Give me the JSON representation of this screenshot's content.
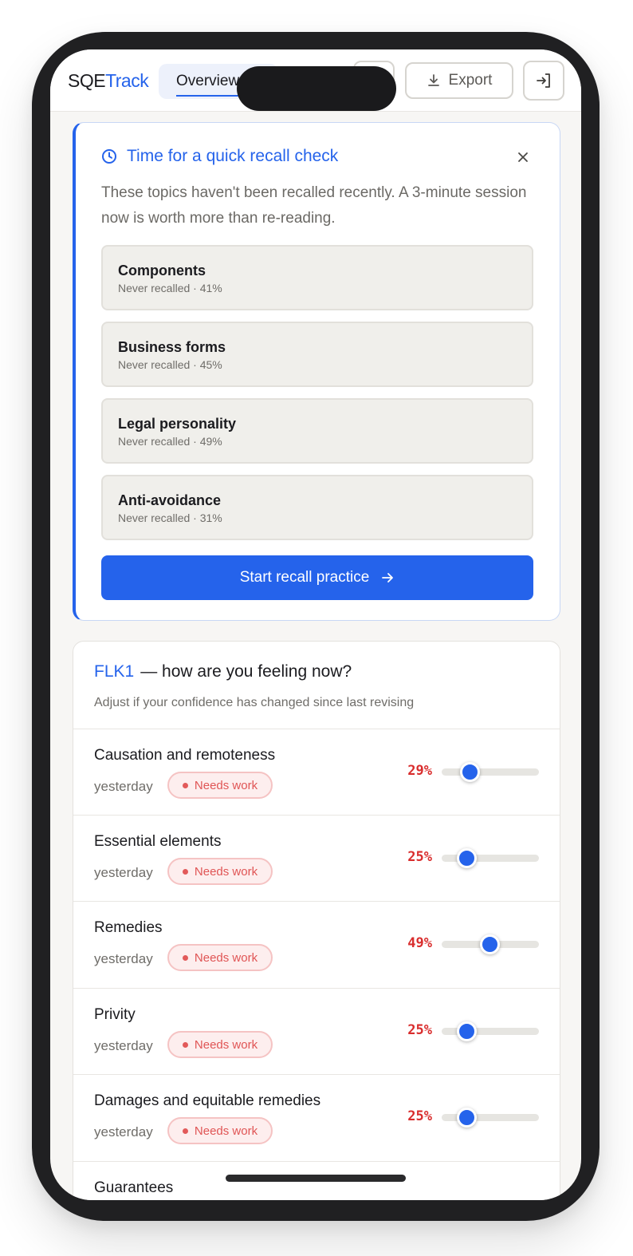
{
  "header": {
    "brand_part1": "SQE",
    "brand_part2": "Track",
    "tab_overview": "Overview",
    "export_label": "Export",
    "icons": [
      "download-icon",
      "login-icon"
    ]
  },
  "recall": {
    "title": "Time for a quick recall check",
    "description": "These topics haven't been recalled recently. A 3-minute session now is worth more than re-reading.",
    "topics": [
      {
        "name": "Components",
        "meta": "Never recalled · 41%"
      },
      {
        "name": "Business forms",
        "meta": "Never recalled · 45%"
      },
      {
        "name": "Legal personality",
        "meta": "Never recalled · 49%"
      },
      {
        "name": "Anti-avoidance",
        "meta": "Never recalled · 31%"
      }
    ],
    "start_label": "Start recall practice"
  },
  "feeling": {
    "code": "FLK1",
    "title_rest": "— how are you feeling now?",
    "subtitle": "Adjust if your confidence has changed since last revising",
    "items": [
      {
        "name": "Causation and remoteness",
        "when": "yesterday",
        "status": "Needs work",
        "percent_label": "29%",
        "value": 29
      },
      {
        "name": "Essential elements",
        "when": "yesterday",
        "status": "Needs work",
        "percent_label": "25%",
        "value": 25
      },
      {
        "name": "Remedies",
        "when": "yesterday",
        "status": "Needs work",
        "percent_label": "49%",
        "value": 49
      },
      {
        "name": "Privity",
        "when": "yesterday",
        "status": "Needs work",
        "percent_label": "25%",
        "value": 25
      },
      {
        "name": "Damages and equitable remedies",
        "when": "yesterday",
        "status": "Needs work",
        "percent_label": "25%",
        "value": 25
      },
      {
        "name": "Guarantees"
      }
    ]
  },
  "colors": {
    "accent": "#2563eb",
    "danger": "#d92d2d",
    "badge_bg": "#fdeeee"
  }
}
